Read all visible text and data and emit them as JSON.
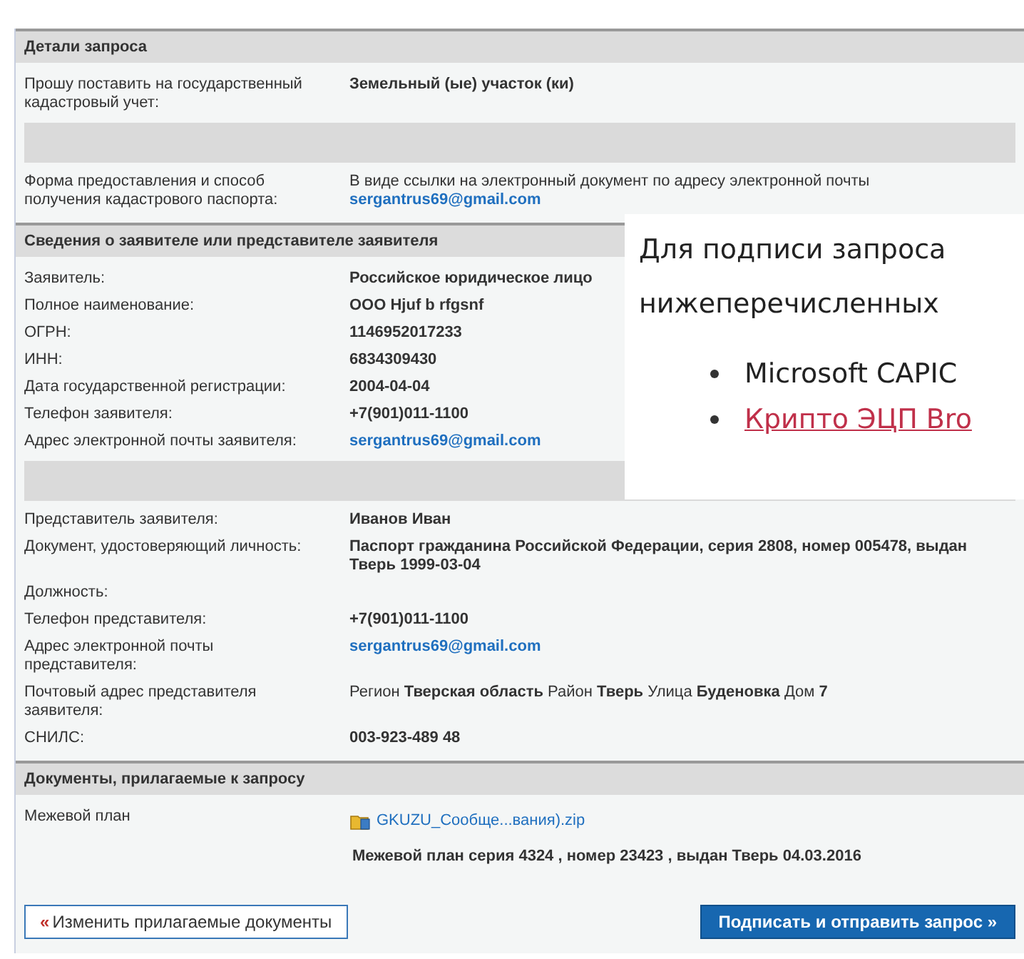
{
  "sections": [
    {
      "title": "Детали запроса",
      "rows": [
        {
          "label": "Прошу поставить на государственный кадастровый учет:",
          "kind": "bold",
          "value": "Земельный (ые) участок (ки)"
        },
        {
          "kind": "spacer"
        },
        {
          "label": "Форма предоставления и способ получения кадастрового паспорта:",
          "kind": "plain-link",
          "value": "В виде ссылки на электронный документ по адресу электронной почты",
          "link": "sergantrus69@gmail.com"
        }
      ]
    },
    {
      "title": "Сведения о заявителе или представителе заявителя",
      "rows": [
        {
          "label": "Заявитель:",
          "kind": "bold",
          "value": "Российское юридическое лицо"
        },
        {
          "label": "Полное наименование:",
          "kind": "bold",
          "value": "ООО Hjuf b rfgsnf"
        },
        {
          "label": "ОГРН:",
          "kind": "bold",
          "value": "1146952017233"
        },
        {
          "label": "ИНН:",
          "kind": "bold",
          "value": "6834309430"
        },
        {
          "label": "Дата государственной регистрации:",
          "kind": "bold",
          "value": "2004-04-04"
        },
        {
          "label": "Телефон заявителя:",
          "kind": "bold",
          "value": "+7(901)011-1100"
        },
        {
          "label": "Адрес электронной почты заявителя:",
          "kind": "link",
          "value": "sergantrus69@gmail.com"
        },
        {
          "kind": "spacer"
        },
        {
          "label": "Представитель заявителя:",
          "kind": "bold",
          "value": "Иванов Иван"
        },
        {
          "label": "Документ, удостоверяющий личность:",
          "kind": "bold",
          "value": "Паспорт гражданина Российской Федерации, серия 2808, номер 005478, выдан Тверь 1999-03-04"
        },
        {
          "label": "Должность:",
          "kind": "bold",
          "value": ""
        },
        {
          "label": "Телефон представителя:",
          "kind": "bold",
          "value": "+7(901)011-1100"
        },
        {
          "label": "Адрес электронной почты представителя:",
          "kind": "link",
          "value": "sergantrus69@gmail.com"
        },
        {
          "label": "Почтовый адрес представителя заявителя:",
          "kind": "rich",
          "value": "Регион **Тверская область** Район **Тверь** Улица **Буденовка** Дом **7**"
        },
        {
          "label": "СНИЛС:",
          "kind": "bold",
          "value": "003-923-489 48"
        }
      ]
    },
    {
      "title": "Документы, прилагаемые к запросу",
      "rows": [
        {
          "label": "Межевой план",
          "kind": "file",
          "value": "GKUZU_Сообще...вания).zip",
          "note": "Межевой план серия 4324 , номер 23423 , выдан Тверь 04.03.2016"
        }
      ]
    }
  ],
  "popup": {
    "lines": [
      "Для подписи запроса",
      "нижеперечисленных"
    ],
    "items": [
      {
        "text": "Microsoft CAPIC",
        "kind": "plain"
      },
      {
        "text": "Крипто ЭЦП Bro",
        "kind": "link"
      }
    ]
  },
  "buttons": {
    "back": {
      "mark": "«",
      "label": "Изменить прилагаемые документы"
    },
    "submit": {
      "label": "Подписать и отправить запрос »"
    }
  }
}
